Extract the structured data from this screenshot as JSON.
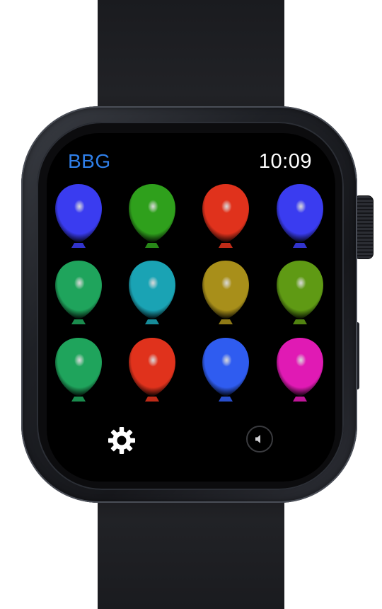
{
  "header": {
    "app_title": "BBG",
    "time": "10:09"
  },
  "colors": {
    "title": "#2f7fe8",
    "clock": "#ffffff",
    "screen_background": "#000000"
  },
  "balloons": [
    {
      "row": 1,
      "col": 1,
      "color": "#3a3cf0"
    },
    {
      "row": 1,
      "col": 2,
      "color": "#2fa01c"
    },
    {
      "row": 1,
      "col": 3,
      "color": "#e0321c"
    },
    {
      "row": 1,
      "col": 4,
      "color": "#3a3cf0"
    },
    {
      "row": 2,
      "col": 1,
      "color": "#1fa45c"
    },
    {
      "row": 2,
      "col": 2,
      "color": "#1aa3b4"
    },
    {
      "row": 2,
      "col": 3,
      "color": "#a88f1a"
    },
    {
      "row": 2,
      "col": 4,
      "color": "#5f9a14"
    },
    {
      "row": 3,
      "col": 1,
      "color": "#1fa45c"
    },
    {
      "row": 3,
      "col": 2,
      "color": "#e0321c"
    },
    {
      "row": 3,
      "col": 3,
      "color": "#2f5cf0"
    },
    {
      "row": 3,
      "col": 4,
      "color": "#e01ab4"
    }
  ],
  "controls": {
    "settings_icon": "gear-icon",
    "sound_icon": "speaker-muted-icon"
  }
}
